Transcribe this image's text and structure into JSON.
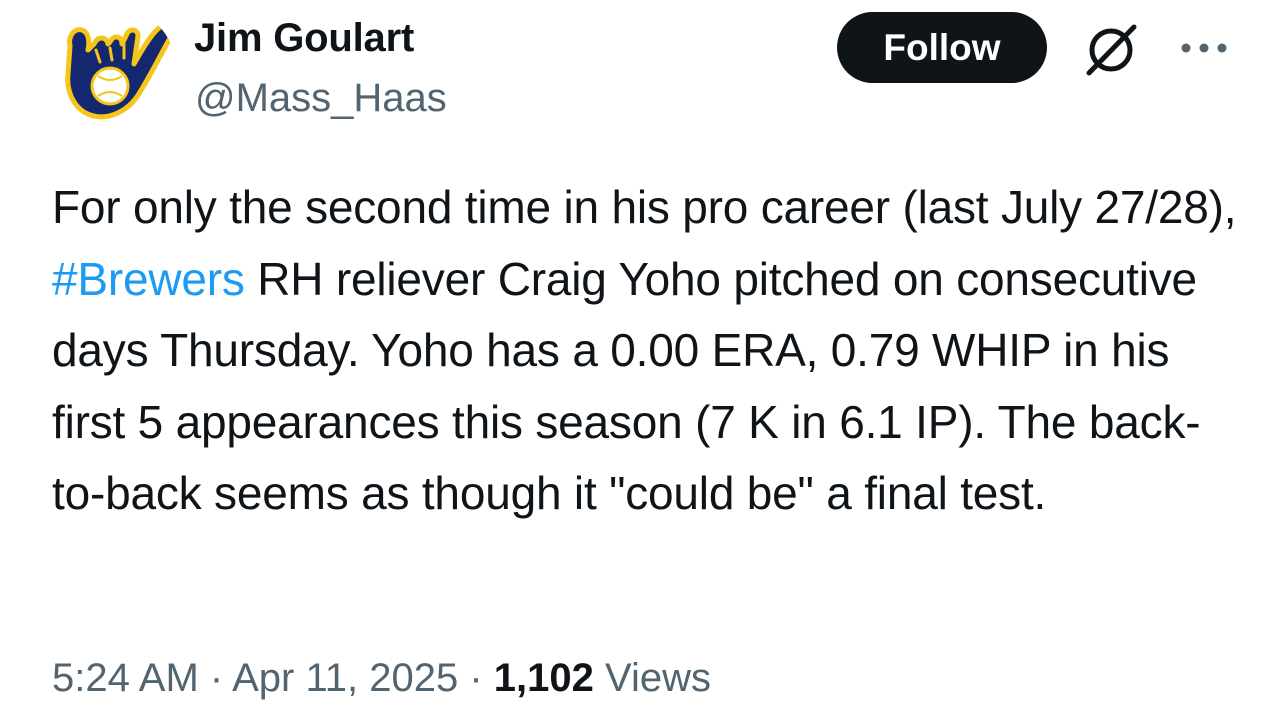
{
  "author": {
    "display_name": "Jim Goulart",
    "handle": "@Mass_Haas",
    "avatar_icon": "brewers-glove-logo-icon"
  },
  "actions": {
    "follow_label": "Follow",
    "grok_icon": "grok-icon",
    "more_icon": "more-options-icon"
  },
  "tweet": {
    "text_before": "For only the second time in his pro career (last July 27/28), ",
    "hashtag": "#Brewers",
    "text_after": " RH reliever Craig Yoho pitched on consecutive days Thursday. Yoho has a 0.00 ERA, 0.79 WHIP in his first 5 appearances this season (7 K in 6.1 IP). The back-to-back seems as though it \"could be\" a final test."
  },
  "meta": {
    "time": "5:24 AM",
    "separator": "·",
    "date": "Apr 11, 2025",
    "views_count": "1,102",
    "views_label": "Views"
  },
  "colors": {
    "text": "#0f1419",
    "secondary": "#536471",
    "link": "#1d9bf0",
    "brand_blue": "#14286f",
    "brand_gold": "#f5c519"
  }
}
